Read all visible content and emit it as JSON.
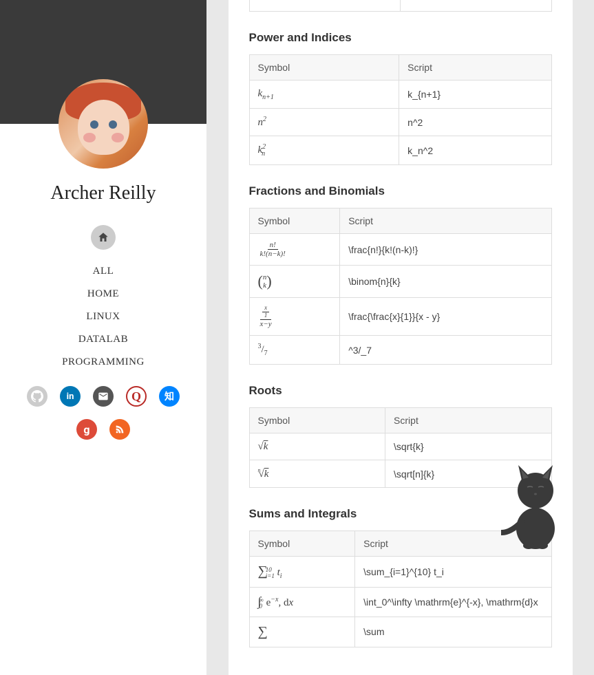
{
  "profile": {
    "name": "Archer Reilly"
  },
  "nav": {
    "items": [
      "ALL",
      "HOME",
      "LINUX",
      "DATALAB",
      "PROGRAMMING"
    ]
  },
  "social": {
    "github": "github",
    "linkedin": "in",
    "email": "✉",
    "quora": "Q",
    "zhihu": "知",
    "google": "g",
    "rss": "rss"
  },
  "headers": {
    "symbol": "Symbol",
    "script": "Script"
  },
  "sections": [
    {
      "title": "Power and Indices",
      "rows": [
        {
          "script": "k_{n+1}"
        },
        {
          "script": "n^2"
        },
        {
          "script": "k_n^2"
        }
      ]
    },
    {
      "title": "Fractions and Binomials",
      "rows": [
        {
          "script": "\\frac{n!}{k!(n-k)!}"
        },
        {
          "script": "\\binom{n}{k}"
        },
        {
          "script": "\\frac{\\frac{x}{1}}{x - y}"
        },
        {
          "script": "^3/_7"
        }
      ]
    },
    {
      "title": "Roots",
      "rows": [
        {
          "script": "\\sqrt{k}"
        },
        {
          "script": "\\sqrt[n]{k}"
        }
      ]
    },
    {
      "title": "Sums and Integrals",
      "rows": [
        {
          "script": "\\sum_{i=1}^{10} t_i"
        },
        {
          "script": "\\int_0^\\infty \\mathrm{e}^{-x}, \\mathrm{d}x"
        },
        {
          "script": "\\sum"
        }
      ]
    }
  ]
}
